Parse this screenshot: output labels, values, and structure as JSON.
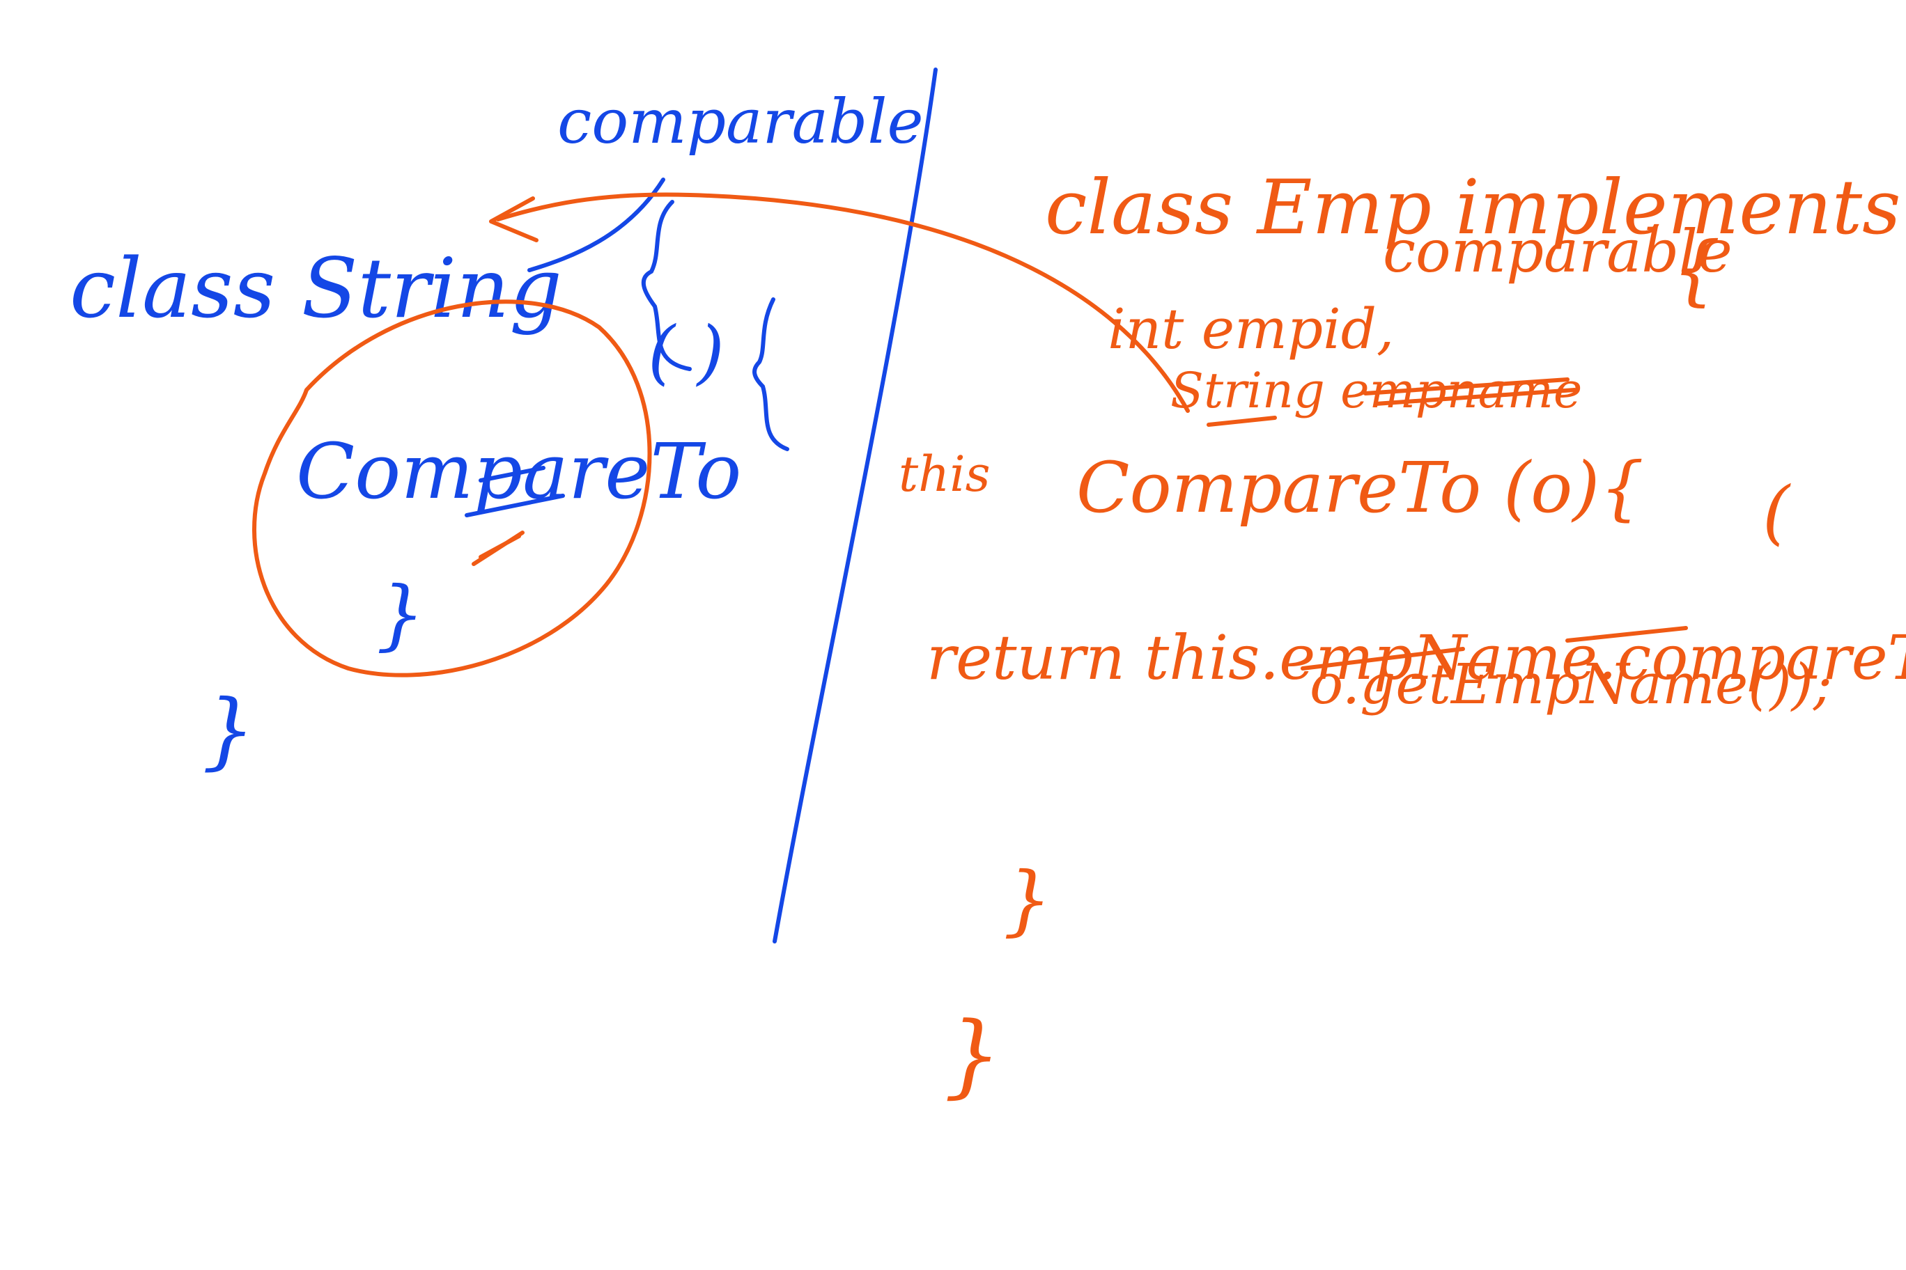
{
  "colors": {
    "ink_blue": "#1447e6",
    "ink_orange": "#f05a14",
    "background": "#ffffff"
  },
  "left_side": {
    "interface_label": "comparable",
    "class_line": "class String",
    "class_open": "{",
    "method_name": "CompareTo",
    "method_parens": "( )",
    "method_open": "{",
    "method_close": "}",
    "class_close": "}"
  },
  "right_side": {
    "class_line1": "class Emp implements",
    "class_line2": "comparable",
    "class_open": "{",
    "field1": "int empid,",
    "field2": "String empname",
    "this_note": "this",
    "method_sig": "CompareTo (o){",
    "method_sig_paren": "(",
    "return_line1": "return this.empName.compareTo",
    "return_line2": "o.getEmpName());",
    "method_close": "}",
    "class_close": "}"
  }
}
